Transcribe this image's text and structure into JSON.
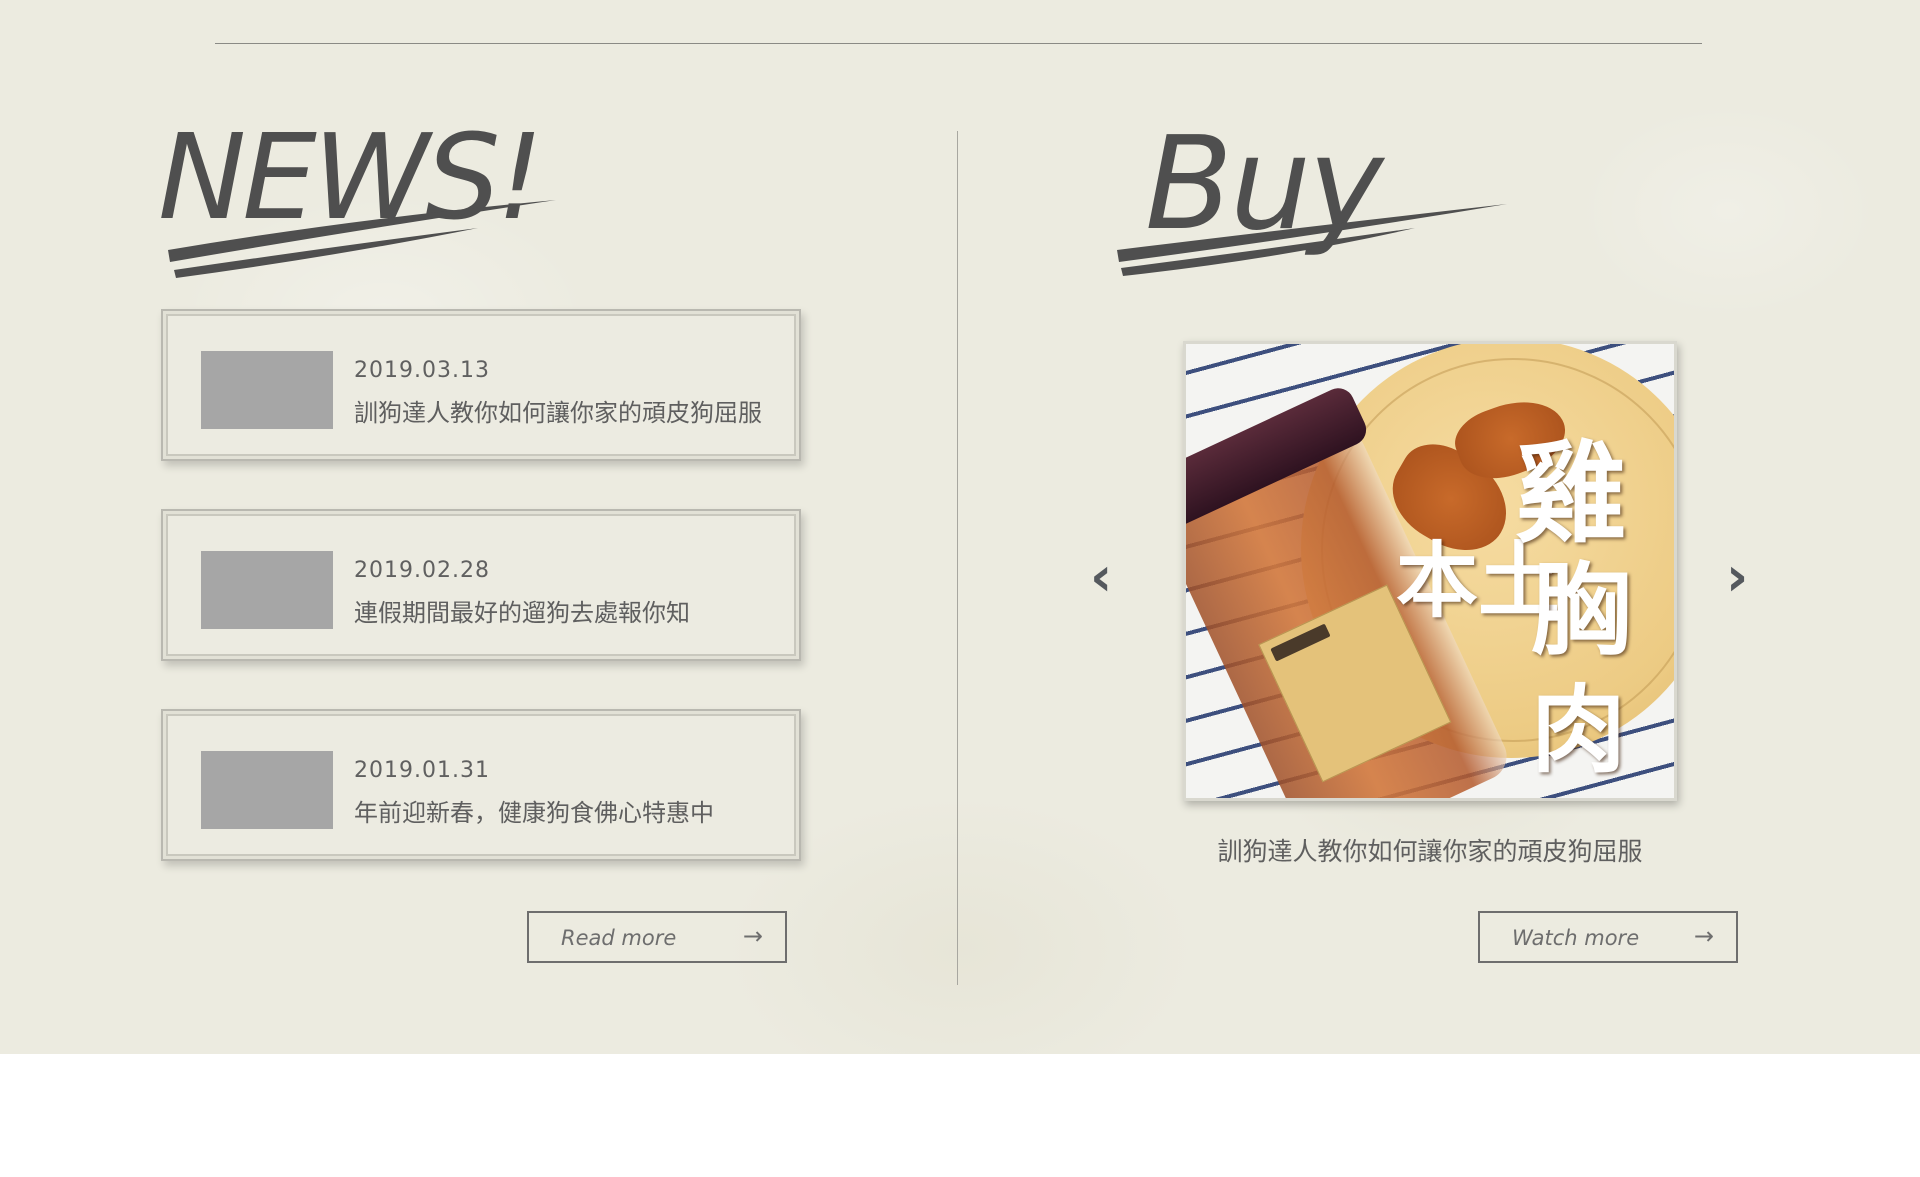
{
  "news": {
    "heading": "NEWS!",
    "items": [
      {
        "date": "2019.03.13",
        "title": "訓狗達人教你如何讓你家的頑皮狗屈服"
      },
      {
        "date": "2019.02.28",
        "title": "連假期間最好的遛狗去處報你知"
      },
      {
        "date": "2019.01.31",
        "title": "年前迎新春，健康狗食佛心特惠中"
      }
    ],
    "button": {
      "label": "Read more",
      "arrow": "→"
    }
  },
  "buy": {
    "heading": "Buy",
    "carousel": {
      "prev": "‹",
      "next": "›",
      "image_text": {
        "line1": "本土",
        "line2": "雞",
        "line3": "胸",
        "line4": "肉"
      }
    },
    "caption": "訓狗達人教你如何讓你家的頑皮狗屈服",
    "button": {
      "label": "Watch more",
      "arrow": "→"
    }
  },
  "colors": {
    "paper": "#ecebe0",
    "text": "#5b5b5b",
    "thumb": "#a6a6a6",
    "stripe": "#3d4f7e"
  },
  "icons": {
    "prev": "chevron-left-icon",
    "next": "chevron-right-icon",
    "arrow": "arrow-right-icon"
  }
}
